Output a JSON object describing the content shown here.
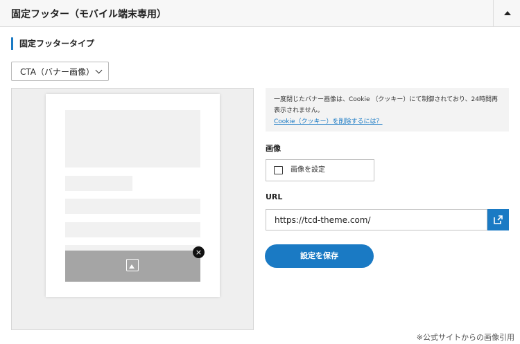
{
  "header": {
    "title": "固定フッター（モバイル端末専用）"
  },
  "section": {
    "title": "固定フッタータイプ"
  },
  "type_select": {
    "value": "CTA（バナー画像）"
  },
  "preview": {
    "close_glyph": "×"
  },
  "notice": {
    "text": "一度閉じたバナー画像は、Cookie （クッキー）にて制御されており、24時間再表示されません。",
    "link": "Cookie（クッキー）を削除するには？"
  },
  "image_field": {
    "label": "画像",
    "button": "画像を設定"
  },
  "url_field": {
    "label": "URL",
    "value": "https://tcd-theme.com/"
  },
  "save": {
    "label": "設定を保存"
  },
  "credit": "※公式サイトからの画像引用",
  "colors": {
    "accent": "#1a7ac4",
    "banner": "#a5a5a5",
    "placeholder": "#f1f1f1"
  }
}
